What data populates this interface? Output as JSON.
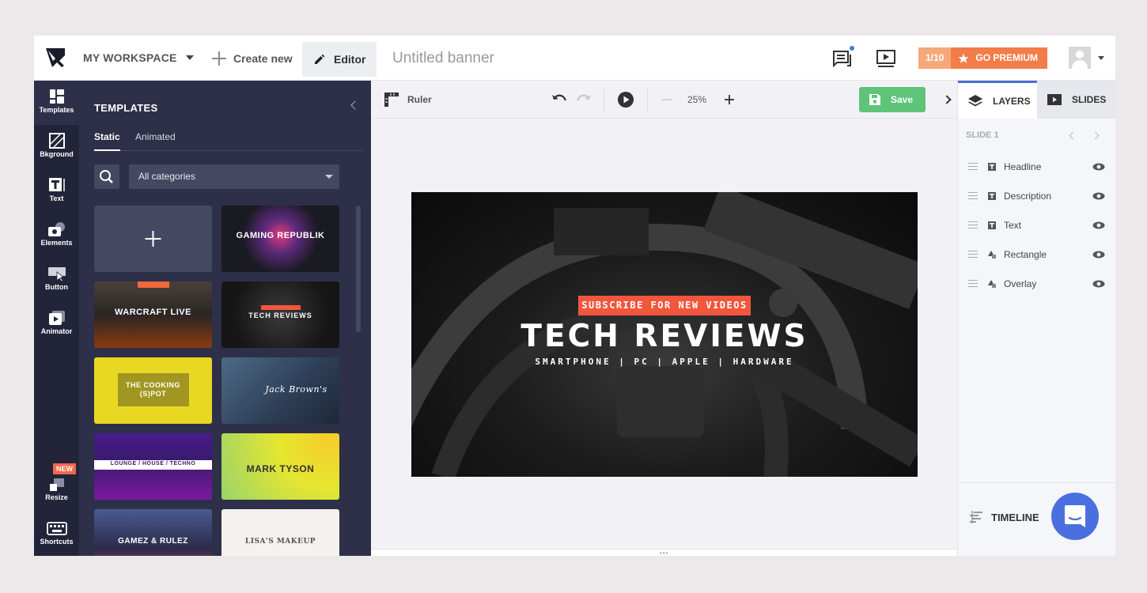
{
  "topbar": {
    "workspace": "MY WORKSPACE",
    "create_new": "Create new",
    "editor": "Editor",
    "title_placeholder": "Untitled banner",
    "premium_count": "1/10",
    "go_premium": "GO PREMIUM"
  },
  "rail": {
    "items": [
      {
        "label": "Templates",
        "icon": "templates-icon"
      },
      {
        "label": "Bkground",
        "icon": "background-icon"
      },
      {
        "label": "Text",
        "icon": "text-icon"
      },
      {
        "label": "Elements",
        "icon": "elements-icon"
      },
      {
        "label": "Button",
        "icon": "button-icon"
      },
      {
        "label": "Animator",
        "icon": "animator-icon"
      },
      {
        "label": "Resize",
        "icon": "resize-icon"
      },
      {
        "label": "Shortcuts",
        "icon": "keyboard-icon"
      }
    ],
    "new_badge": "NEW"
  },
  "templates": {
    "title": "TEMPLATES",
    "tabs": [
      "Static",
      "Animated"
    ],
    "category": "All categories",
    "thumbs": [
      {
        "label": "GAMING REPUBLIK",
        "color": "#1a1a22"
      },
      {
        "label": "WARCRAFT LIVE",
        "color": "#2a2624"
      },
      {
        "label": "TECH REVIEWS",
        "color": "#1c1c1c"
      },
      {
        "label": "THE COOKING (S)POT",
        "color": "#e8d824"
      },
      {
        "label": "Jack Brown's",
        "color": "#2c3d55"
      },
      {
        "label": "LOUNGE / HOUSE / TECHNO",
        "color": "#3a1a6e"
      },
      {
        "label": "MARK TYSON",
        "color": "#e6e630"
      },
      {
        "label": "GAMEZ & RULEZ",
        "color": "#2a2c4a"
      },
      {
        "label": "LISA'S MAKEUP",
        "color": "#f4f1ee"
      }
    ]
  },
  "canvas": {
    "ruler": "Ruler",
    "zoom": "25%",
    "save": "Save",
    "banner": {
      "subscribe": "SUBSCRIBE FOR NEW VIDEOS",
      "title": "TECH REVIEWS",
      "subtitle": "SMARTPHONE | PC | APPLE | HARDWARE"
    }
  },
  "rpanel": {
    "tabs": [
      "LAYERS",
      "SLIDES"
    ],
    "slide_label": "SLIDE 1",
    "layers": [
      {
        "name": "Headline",
        "type": "text"
      },
      {
        "name": "Description",
        "type": "text"
      },
      {
        "name": "Text",
        "type": "text"
      },
      {
        "name": "Rectangle",
        "type": "shape"
      },
      {
        "name": "Overlay",
        "type": "shape"
      }
    ],
    "timeline": "TIMELINE"
  },
  "colors": {
    "accent": "#f27d48",
    "save": "#5fc37a",
    "panel_dark": "#2d3048",
    "rail_dark": "#22243a",
    "link_blue": "#4a70e0"
  }
}
